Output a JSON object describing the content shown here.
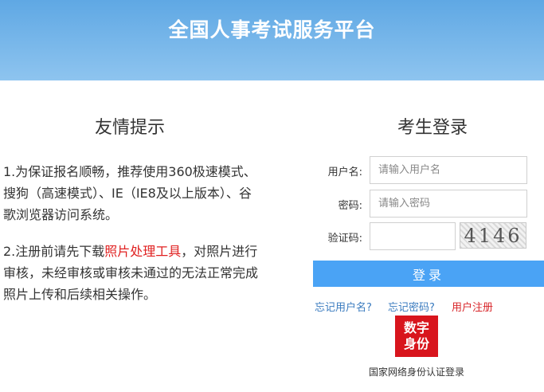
{
  "header": {
    "title": "全国人事考试服务平台"
  },
  "tips": {
    "title": "友情提示",
    "tip1": "1.为保证报名顺畅，推荐使用360极速模式、搜狗（高速模式）、IE（IE8及以上版本）、谷歌浏览器访问系统。",
    "tip2_before": "2.注册前请先下载",
    "tip2_link": "照片处理工具",
    "tip2_after": "，对照片进行审核，未经审核或审核未通过的无法正常完成照片上传和后续相关操作。"
  },
  "login": {
    "title": "考生登录",
    "username_label": "用户名:",
    "username_placeholder": "请输入用户名",
    "password_label": "密码:",
    "password_placeholder": "请输入密码",
    "captcha_label": "验证码:",
    "captcha_code": "4146",
    "submit_label": "登录",
    "forgot_username": "忘记用户名?",
    "forgot_password": "忘记密码?",
    "register": "用户注册",
    "digital_id_logo_line1": "数字",
    "digital_id_logo_line2": "身份",
    "digital_id_caption": "国家网络身份认证登录"
  },
  "colors": {
    "header_top": "#5fa8e4",
    "header_bottom": "#8ec4ef",
    "button": "#4aa3f5",
    "link": "#3a7bbf",
    "accent_red": "#d8262a"
  }
}
